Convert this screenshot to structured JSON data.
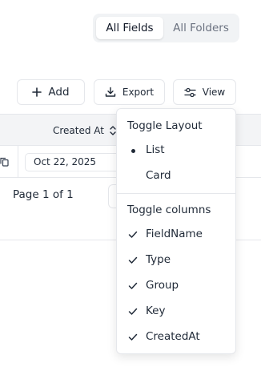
{
  "view_toggle": {
    "options": [
      "All Fields",
      "All Folders"
    ],
    "selected": "All Fields"
  },
  "toolbar": {
    "add_label": "Add",
    "export_label": "Export",
    "view_label": "View"
  },
  "table": {
    "header": {
      "created_at": "Created At"
    },
    "rows": [
      {
        "created_at": "Oct 22, 2025"
      }
    ]
  },
  "pagination": {
    "text": "Page 1 of 1"
  },
  "view_menu": {
    "layout_heading": "Toggle Layout",
    "layout_options": [
      {
        "label": "List",
        "selected": true
      },
      {
        "label": "Card",
        "selected": false
      }
    ],
    "columns_heading": "Toggle columns",
    "columns": [
      {
        "label": "FieldName",
        "checked": true
      },
      {
        "label": "Type",
        "checked": true
      },
      {
        "label": "Group",
        "checked": true
      },
      {
        "label": "Key",
        "checked": true
      },
      {
        "label": "CreatedAt",
        "checked": true
      }
    ]
  }
}
